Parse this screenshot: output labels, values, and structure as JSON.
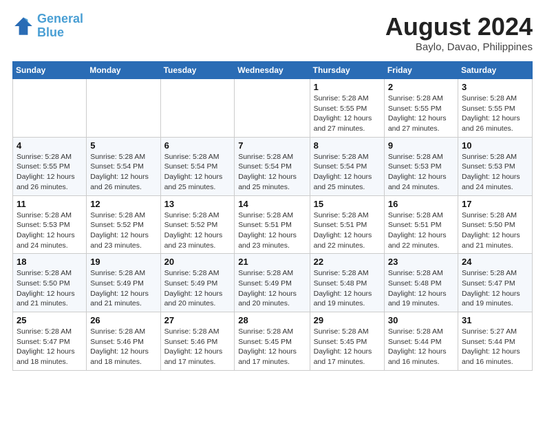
{
  "header": {
    "logo_line1": "General",
    "logo_line2": "Blue",
    "title": "August 2024",
    "subtitle": "Baylo, Davao, Philippines"
  },
  "days_of_week": [
    "Sunday",
    "Monday",
    "Tuesday",
    "Wednesday",
    "Thursday",
    "Friday",
    "Saturday"
  ],
  "weeks": [
    [
      {
        "day": "",
        "detail": ""
      },
      {
        "day": "",
        "detail": ""
      },
      {
        "day": "",
        "detail": ""
      },
      {
        "day": "",
        "detail": ""
      },
      {
        "day": "1",
        "detail": "Sunrise: 5:28 AM\nSunset: 5:55 PM\nDaylight: 12 hours\nand 27 minutes."
      },
      {
        "day": "2",
        "detail": "Sunrise: 5:28 AM\nSunset: 5:55 PM\nDaylight: 12 hours\nand 27 minutes."
      },
      {
        "day": "3",
        "detail": "Sunrise: 5:28 AM\nSunset: 5:55 PM\nDaylight: 12 hours\nand 26 minutes."
      }
    ],
    [
      {
        "day": "4",
        "detail": "Sunrise: 5:28 AM\nSunset: 5:55 PM\nDaylight: 12 hours\nand 26 minutes."
      },
      {
        "day": "5",
        "detail": "Sunrise: 5:28 AM\nSunset: 5:54 PM\nDaylight: 12 hours\nand 26 minutes."
      },
      {
        "day": "6",
        "detail": "Sunrise: 5:28 AM\nSunset: 5:54 PM\nDaylight: 12 hours\nand 25 minutes."
      },
      {
        "day": "7",
        "detail": "Sunrise: 5:28 AM\nSunset: 5:54 PM\nDaylight: 12 hours\nand 25 minutes."
      },
      {
        "day": "8",
        "detail": "Sunrise: 5:28 AM\nSunset: 5:54 PM\nDaylight: 12 hours\nand 25 minutes."
      },
      {
        "day": "9",
        "detail": "Sunrise: 5:28 AM\nSunset: 5:53 PM\nDaylight: 12 hours\nand 24 minutes."
      },
      {
        "day": "10",
        "detail": "Sunrise: 5:28 AM\nSunset: 5:53 PM\nDaylight: 12 hours\nand 24 minutes."
      }
    ],
    [
      {
        "day": "11",
        "detail": "Sunrise: 5:28 AM\nSunset: 5:53 PM\nDaylight: 12 hours\nand 24 minutes."
      },
      {
        "day": "12",
        "detail": "Sunrise: 5:28 AM\nSunset: 5:52 PM\nDaylight: 12 hours\nand 23 minutes."
      },
      {
        "day": "13",
        "detail": "Sunrise: 5:28 AM\nSunset: 5:52 PM\nDaylight: 12 hours\nand 23 minutes."
      },
      {
        "day": "14",
        "detail": "Sunrise: 5:28 AM\nSunset: 5:51 PM\nDaylight: 12 hours\nand 23 minutes."
      },
      {
        "day": "15",
        "detail": "Sunrise: 5:28 AM\nSunset: 5:51 PM\nDaylight: 12 hours\nand 22 minutes."
      },
      {
        "day": "16",
        "detail": "Sunrise: 5:28 AM\nSunset: 5:51 PM\nDaylight: 12 hours\nand 22 minutes."
      },
      {
        "day": "17",
        "detail": "Sunrise: 5:28 AM\nSunset: 5:50 PM\nDaylight: 12 hours\nand 21 minutes."
      }
    ],
    [
      {
        "day": "18",
        "detail": "Sunrise: 5:28 AM\nSunset: 5:50 PM\nDaylight: 12 hours\nand 21 minutes."
      },
      {
        "day": "19",
        "detail": "Sunrise: 5:28 AM\nSunset: 5:49 PM\nDaylight: 12 hours\nand 21 minutes."
      },
      {
        "day": "20",
        "detail": "Sunrise: 5:28 AM\nSunset: 5:49 PM\nDaylight: 12 hours\nand 20 minutes."
      },
      {
        "day": "21",
        "detail": "Sunrise: 5:28 AM\nSunset: 5:49 PM\nDaylight: 12 hours\nand 20 minutes."
      },
      {
        "day": "22",
        "detail": "Sunrise: 5:28 AM\nSunset: 5:48 PM\nDaylight: 12 hours\nand 19 minutes."
      },
      {
        "day": "23",
        "detail": "Sunrise: 5:28 AM\nSunset: 5:48 PM\nDaylight: 12 hours\nand 19 minutes."
      },
      {
        "day": "24",
        "detail": "Sunrise: 5:28 AM\nSunset: 5:47 PM\nDaylight: 12 hours\nand 19 minutes."
      }
    ],
    [
      {
        "day": "25",
        "detail": "Sunrise: 5:28 AM\nSunset: 5:47 PM\nDaylight: 12 hours\nand 18 minutes."
      },
      {
        "day": "26",
        "detail": "Sunrise: 5:28 AM\nSunset: 5:46 PM\nDaylight: 12 hours\nand 18 minutes."
      },
      {
        "day": "27",
        "detail": "Sunrise: 5:28 AM\nSunset: 5:46 PM\nDaylight: 12 hours\nand 17 minutes."
      },
      {
        "day": "28",
        "detail": "Sunrise: 5:28 AM\nSunset: 5:45 PM\nDaylight: 12 hours\nand 17 minutes."
      },
      {
        "day": "29",
        "detail": "Sunrise: 5:28 AM\nSunset: 5:45 PM\nDaylight: 12 hours\nand 17 minutes."
      },
      {
        "day": "30",
        "detail": "Sunrise: 5:28 AM\nSunset: 5:44 PM\nDaylight: 12 hours\nand 16 minutes."
      },
      {
        "day": "31",
        "detail": "Sunrise: 5:27 AM\nSunset: 5:44 PM\nDaylight: 12 hours\nand 16 minutes."
      }
    ]
  ]
}
